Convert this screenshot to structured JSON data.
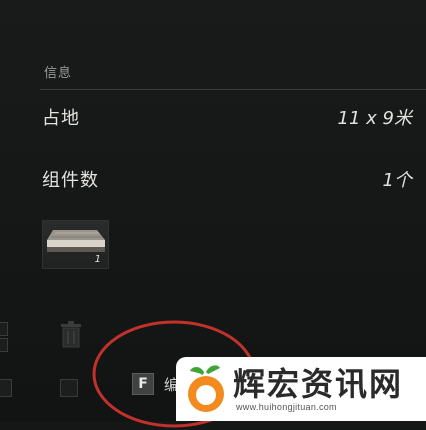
{
  "info_panel": {
    "section_title": "信息",
    "rows": [
      {
        "label": "占地",
        "value": "11 x 9米"
      },
      {
        "label": "组件数",
        "value": "1个"
      }
    ],
    "component_thumbnail": {
      "count": "1"
    }
  },
  "action_bar": {
    "key": "F",
    "label": "编"
  },
  "watermark": {
    "title": "辉宏资讯网",
    "url": "www.huihongjituan.com"
  },
  "colors": {
    "background": "#151717",
    "annotation_circle": "#c0322a",
    "watermark_orange": "#f28a1e",
    "watermark_green": "#3fa535"
  },
  "icons": [
    "trash-icon",
    "grid-icon",
    "component-thumbnail"
  ]
}
